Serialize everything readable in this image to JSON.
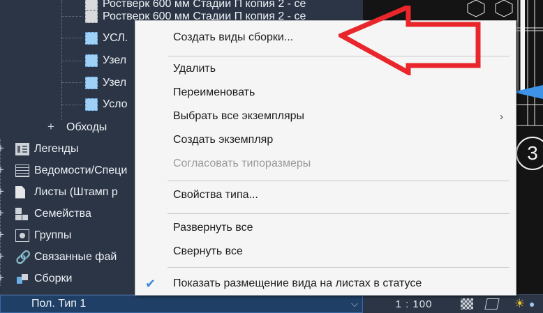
{
  "tree": {
    "rows_top": [
      {
        "label": "Ростверк 600 мм Стадии П копия 2 - се",
        "icon": "gray-view-icon"
      },
      {
        "label": "Ростверк 600 мм Стадии П копия 2 - се",
        "icon": "gray-view-icon"
      },
      {
        "label": "УСЛ.",
        "icon": "blue-view-icon"
      },
      {
        "label": "Узел",
        "icon": "blue-view-icon"
      },
      {
        "label": "Узел",
        "icon": "blue-view-icon"
      },
      {
        "label": "Усло",
        "icon": "blue-view-icon"
      }
    ],
    "obkhody": "Обходы",
    "categories": [
      {
        "label": "Легенды",
        "icon": "legend-icon"
      },
      {
        "label": "Ведомости/Специ",
        "icon": "schedule-icon"
      },
      {
        "label": "Листы (Штамп р",
        "icon": "sheet-icon"
      },
      {
        "label": "Семейства",
        "icon": "family-icon"
      },
      {
        "label": "Группы",
        "icon": "group-icon"
      },
      {
        "label": "Связанные фай",
        "icon": "link-icon"
      },
      {
        "label": "Сборки",
        "icon": "assembly-icon"
      }
    ]
  },
  "status": {
    "type_selector": "Пол. Тип 1",
    "scale": "1 : 100"
  },
  "drawing": {
    "tag_number": "3"
  },
  "context_menu": {
    "create_assembly_views": "Создать виды сборки...",
    "delete": "Удалить",
    "rename": "Переименовать",
    "select_all_instances": "Выбрать все экземпляры",
    "create_instance": "Создать экземпляр",
    "match_type_sizes": "Согласовать типоразмеры",
    "type_properties": "Свойства типа...",
    "expand_all": "Развернуть все",
    "collapse_all": "Свернуть все",
    "show_view_placement": "Показать размещение вида на листах в статусе"
  },
  "colors": {
    "annotation_arrow": "#e8262b",
    "menu_background": "#f5f5f5",
    "browser_background": "#2b3546",
    "selected_field": "#1f3f66"
  }
}
